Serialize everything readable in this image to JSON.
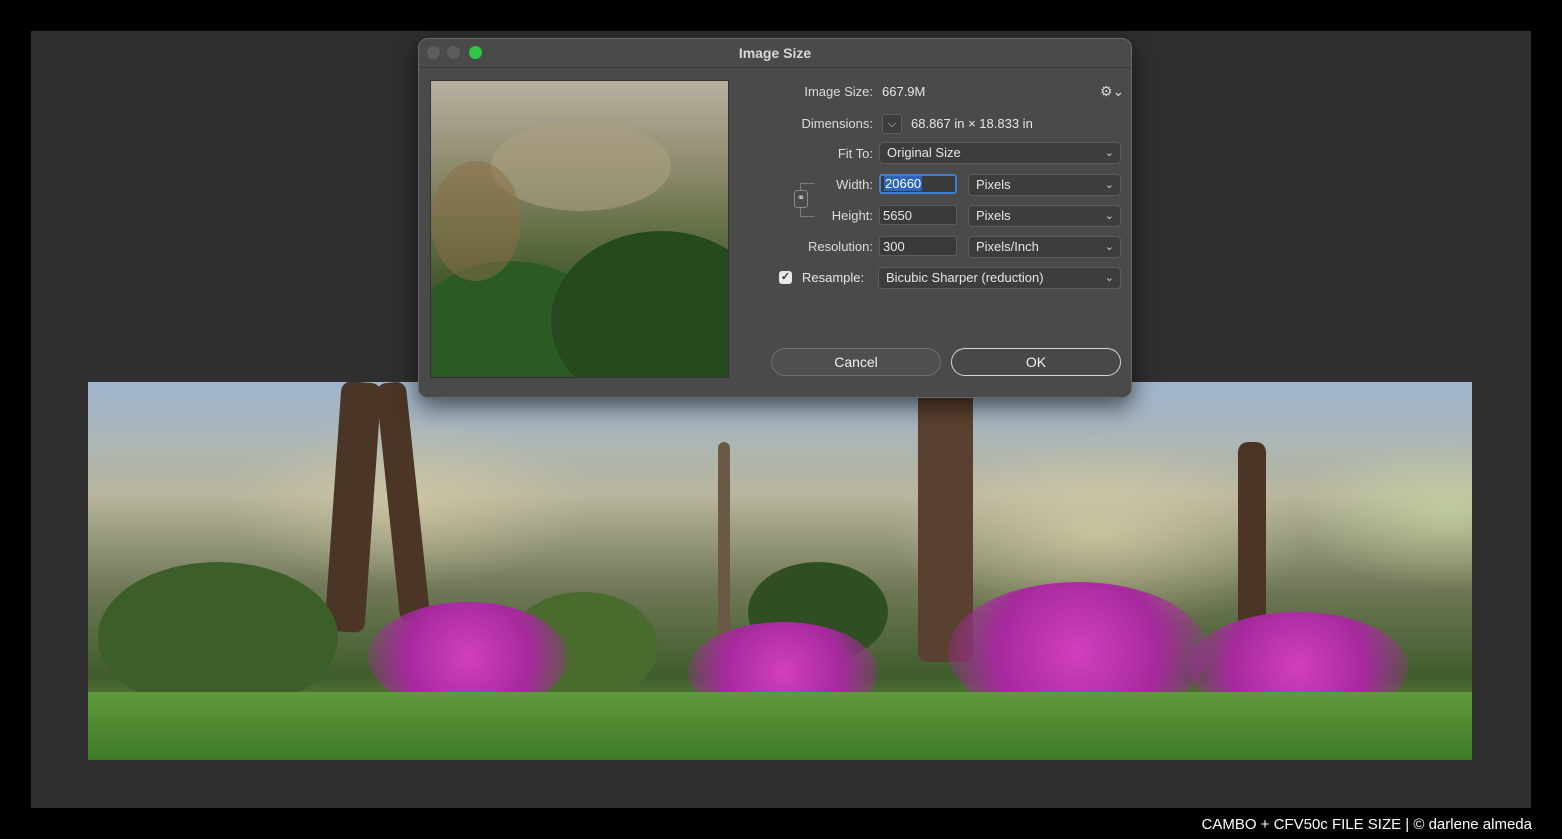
{
  "dialog": {
    "title": "Image Size",
    "image_size_label": "Image Size:",
    "image_size_value": "667.9M",
    "dimensions_label": "Dimensions:",
    "dimensions_value": "68.867 in  ×  18.833 in",
    "fit_to_label": "Fit To:",
    "fit_to_value": "Original Size",
    "width_label": "Width:",
    "width_value": "20660",
    "width_unit": "Pixels",
    "height_label": "Height:",
    "height_value": "5650",
    "height_unit": "Pixels",
    "resolution_label": "Resolution:",
    "resolution_value": "300",
    "resolution_unit": "Pixels/Inch",
    "resample_label": "Resample:",
    "resample_checked": true,
    "resample_value": "Bicubic Sharper (reduction)",
    "cancel_label": "Cancel",
    "ok_label": "OK",
    "icons": {
      "settings": "gear-icon",
      "link": "chain-link-icon",
      "dimensions_menu": "chevron-down-icon"
    },
    "colors": {
      "zoom_light": "#30c748",
      "selection": "#2e66b8",
      "focus_ring": "#3d7fd6"
    }
  },
  "caption": "CAMBO + CFV50c FILE SIZE | © darlene almeda"
}
